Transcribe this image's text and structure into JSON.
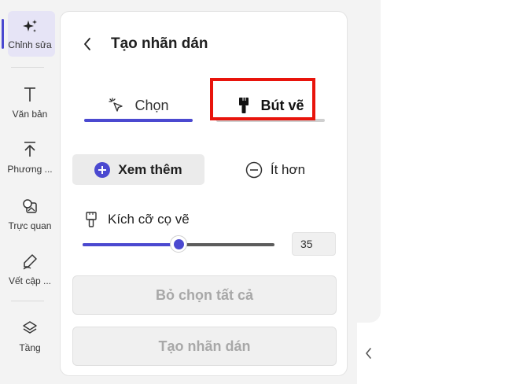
{
  "rail": {
    "items": [
      {
        "label": "Chỉnh sửa",
        "icon": "sparkle-icon",
        "active": true
      },
      {
        "label": "Văn bản",
        "icon": "text-icon"
      },
      {
        "label": "Phương ...",
        "icon": "upload-icon"
      },
      {
        "label": "Trực quan",
        "icon": "visuals-icon"
      },
      {
        "label": "Vết cập ...",
        "icon": "pen-icon"
      },
      {
        "label": "Tầng",
        "icon": "layers-icon"
      }
    ]
  },
  "panel": {
    "title": "Tạo nhãn dán",
    "tabs": [
      {
        "label": "Chọn",
        "icon": "cursor-sparkle-icon",
        "selected": false
      },
      {
        "label": "Bút vẽ",
        "icon": "brush-icon",
        "selected": true
      }
    ],
    "mode": {
      "more_label": "Xem thêm",
      "less_label": "Ít hơn"
    },
    "brush_size": {
      "label": "Kích cỡ cọ vẽ",
      "value": "35",
      "fraction": 0.5
    },
    "deselect_all_label": "Bỏ chọn tất cả",
    "create_sticker_label": "Tạo nhãn dán"
  },
  "colors": {
    "accent": "#4b49d0",
    "highlight": "#e8140c"
  }
}
